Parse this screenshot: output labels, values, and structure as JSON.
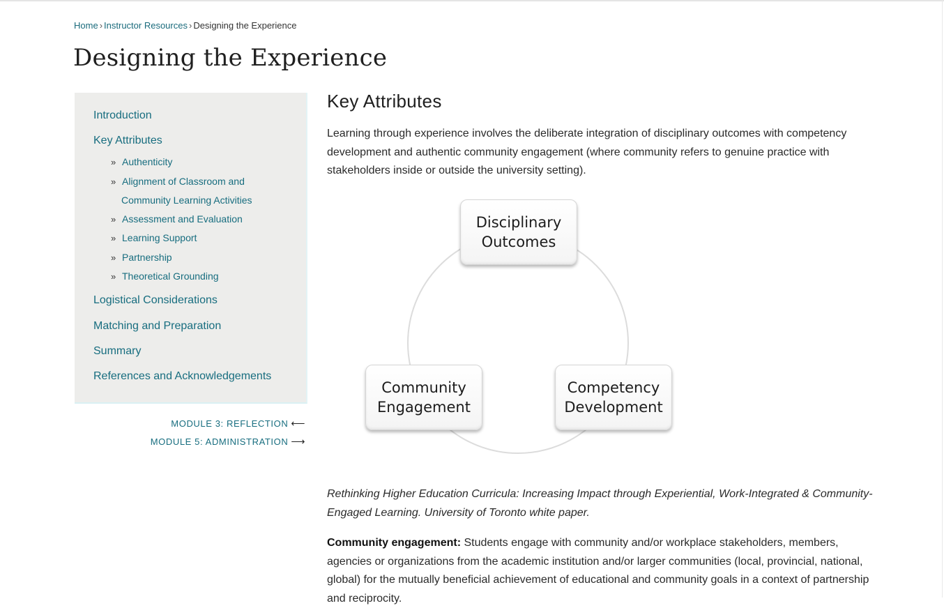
{
  "breadcrumb": {
    "home": "Home",
    "separator": "›",
    "instructor_resources": "Instructor Resources",
    "current": "Designing the Experience"
  },
  "page": {
    "title": "Designing the Experience"
  },
  "sidebar": {
    "items": [
      {
        "label": "Introduction"
      },
      {
        "label": "Key Attributes"
      },
      {
        "label": "Logistical Considerations"
      },
      {
        "label": "Matching and Preparation"
      },
      {
        "label": "Summary"
      },
      {
        "label": "References and Acknowledgements"
      }
    ],
    "chevron": "»",
    "sub_items": [
      {
        "label": "Authenticity"
      },
      {
        "label": "Alignment of Classroom and",
        "label_cont": "Community Learning Activities"
      },
      {
        "label": "Assessment and Evaluation"
      },
      {
        "label": "Learning Support"
      },
      {
        "label": "Partnership"
      },
      {
        "label": "Theoretical Grounding"
      }
    ]
  },
  "modules": {
    "prev_label": "MODULE 3: REFLECTION",
    "prev_arrow": "⟵",
    "next_label": "MODULE 5: ADMINISTRATION",
    "next_arrow": "⟶"
  },
  "content": {
    "heading": "Key Attributes",
    "intro": "Learning through experience involves the deliberate integration of disciplinary outcomes with competency development and authentic community engagement (where community refers to genuine practice with stakeholders inside or outside the university setting).",
    "diagram": {
      "top_line1": "Disciplinary",
      "top_line2": "Outcomes",
      "left_line1": "Community",
      "left_line2": "Engagement",
      "right_line1": "Competency",
      "right_line2": "Development"
    },
    "caption": "Rethinking Higher Education Curricula: Increasing Impact through Experiential, Work-Integrated & Community-Engaged Learning. University of Toronto white paper.",
    "para_label": "Community engagement:",
    "para_text": " Students engage with community and/or workplace stakeholders, members, agencies or organizations from the academic institution and/or larger communities (local, provincial, national, global) for the mutually beneficial achievement of educational and community goals in a context of partnership and reciprocity."
  },
  "colors": {
    "link": "#176d7f",
    "sidebar_bg": "#ededeb"
  }
}
